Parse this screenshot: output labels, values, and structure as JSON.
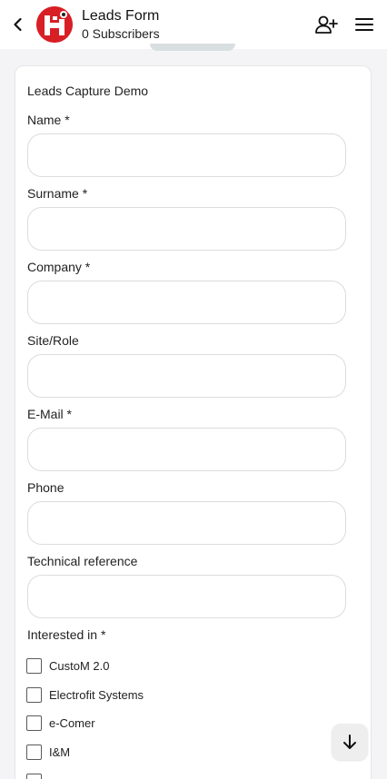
{
  "header": {
    "title": "Leads Form",
    "subtitle": "0 Subscribers",
    "avatar_color": "#d81f26"
  },
  "form": {
    "title": "Leads Capture Demo",
    "fields": [
      {
        "label": "Name *",
        "value": ""
      },
      {
        "label": "Surname *",
        "value": ""
      },
      {
        "label": "Company *",
        "value": ""
      },
      {
        "label": "Site/Role",
        "value": ""
      },
      {
        "label": "E-Mail *",
        "value": ""
      },
      {
        "label": "Phone",
        "value": ""
      },
      {
        "label": "Technical reference",
        "value": ""
      }
    ],
    "interest_label": "Interested in *",
    "options": [
      {
        "label": "CustoM 2.0",
        "checked": false
      },
      {
        "label": "Electrofit Systems",
        "checked": false
      },
      {
        "label": "e-Comer",
        "checked": false
      },
      {
        "label": "I&M",
        "checked": false
      }
    ]
  },
  "icons": {
    "back": "chevron-left-icon",
    "add_subscriber": "add-user-icon",
    "menu": "hamburger-menu-icon",
    "scroll_down": "arrow-down-icon"
  }
}
